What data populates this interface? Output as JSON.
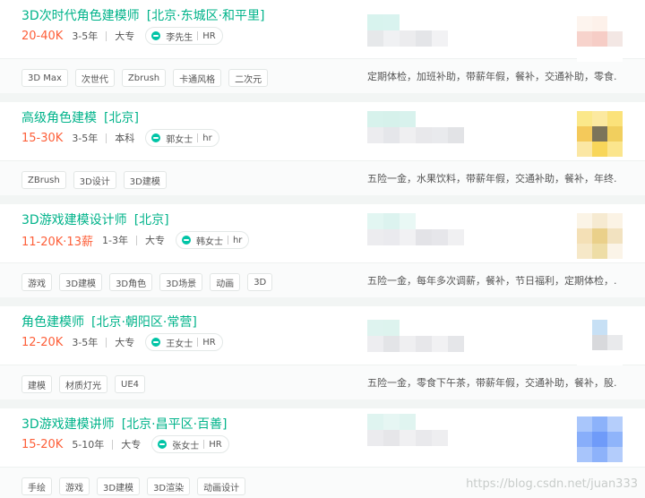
{
  "jobs": [
    {
      "title": "3D次时代角色建模师",
      "location": "[北京·东城区·和平里]",
      "salary": "20-40K",
      "experience": "3-5年",
      "education": "大专",
      "recruiter_name": "李先生",
      "recruiter_role": "HR",
      "tags": [
        "3D Max",
        "次世代",
        "Zbrush",
        "卡通风格",
        "二次元"
      ],
      "benefits": "定期体检，加班补助，带薪年假，餐补，交通补助，零食..."
    },
    {
      "title": "高级角色建模",
      "location": "[北京]",
      "salary": "15-30K",
      "experience": "3-5年",
      "education": "本科",
      "recruiter_name": "郭女士",
      "recruiter_role": "hr",
      "tags": [
        "ZBrush",
        "3D设计",
        "3D建模"
      ],
      "benefits": "五险一金，水果饮料，带薪年假，交通补助，餐补，年终..."
    },
    {
      "title": "3D游戏建模设计师",
      "location": "[北京]",
      "salary": "11-20K·13薪",
      "experience": "1-3年",
      "education": "大专",
      "recruiter_name": "韩女士",
      "recruiter_role": "hr",
      "tags": [
        "游戏",
        "3D建模",
        "3D角色",
        "3D场景",
        "动画",
        "3D"
      ],
      "benefits": "五险一金，每年多次调薪，餐补，节日福利，定期体检，..."
    },
    {
      "title": "角色建模师",
      "location": "[北京·朝阳区·常营]",
      "salary": "12-20K",
      "experience": "3-5年",
      "education": "大专",
      "recruiter_name": "王女士",
      "recruiter_role": "HR",
      "tags": [
        "建模",
        "材质灯光",
        "UE4"
      ],
      "benefits": "五险一金，零食下午茶，带薪年假，交通补助，餐补，股..."
    },
    {
      "title": "3D游戏建模讲师",
      "location": "[北京·昌平区·百善]",
      "salary": "15-20K",
      "experience": "5-10年",
      "education": "大专",
      "recruiter_name": "张女士",
      "recruiter_role": "HR",
      "tags": [
        "手绘",
        "游戏",
        "3D建模",
        "3D渲染",
        "动画设计"
      ],
      "benefits": ""
    }
  ],
  "watermark": "https://blog.csdn.net/juan333"
}
